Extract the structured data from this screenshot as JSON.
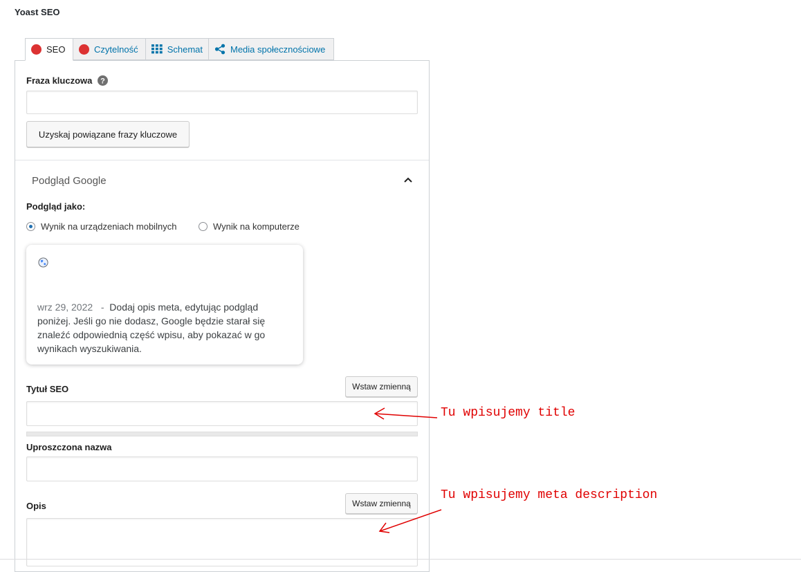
{
  "panel": {
    "title": "Yoast SEO"
  },
  "tabs": [
    {
      "label": "SEO"
    },
    {
      "label": "Czytelność"
    },
    {
      "label": "Schemat"
    },
    {
      "label": "Media społecznościowe"
    }
  ],
  "keyphrase": {
    "label": "Fraza kluczowa",
    "value": "",
    "related_button": "Uzyskaj powiązane frazy kluczowe"
  },
  "google_preview": {
    "heading": "Podgląd Google",
    "preview_as_label": "Podgląd jako:",
    "options": [
      "Wynik na urządzeniach mobilnych",
      "Wynik na komputerze"
    ],
    "selected": "Wynik na urządzeniach mobilnych",
    "snippet": {
      "date": "wrz 29, 2022",
      "separator": "-",
      "description": "Dodaj opis meta, edytując podgląd poniżej. Jeśli go nie dodasz, Google będzie starał się znaleźć odpowiednią część wpisu, aby pokazać w go wynikach wyszukiwania."
    }
  },
  "seo_title": {
    "label": "Tytuł SEO",
    "insert_variable": "Wstaw zmienną",
    "value": ""
  },
  "slug": {
    "label": "Uproszczona nazwa",
    "value": ""
  },
  "meta_description": {
    "label": "Opis",
    "insert_variable": "Wstaw zmienną",
    "value": ""
  },
  "annotations": {
    "title_note": "Tu wpisujemy title",
    "description_note": "Tu wpisujemy meta description"
  },
  "colors": {
    "error_dot": "#dc3232",
    "link_blue": "#0073aa",
    "annotation_red": "#e00000"
  },
  "icons": [
    "help-icon",
    "chevron-up-icon",
    "grid-icon",
    "share-icon",
    "globe-icon"
  ]
}
